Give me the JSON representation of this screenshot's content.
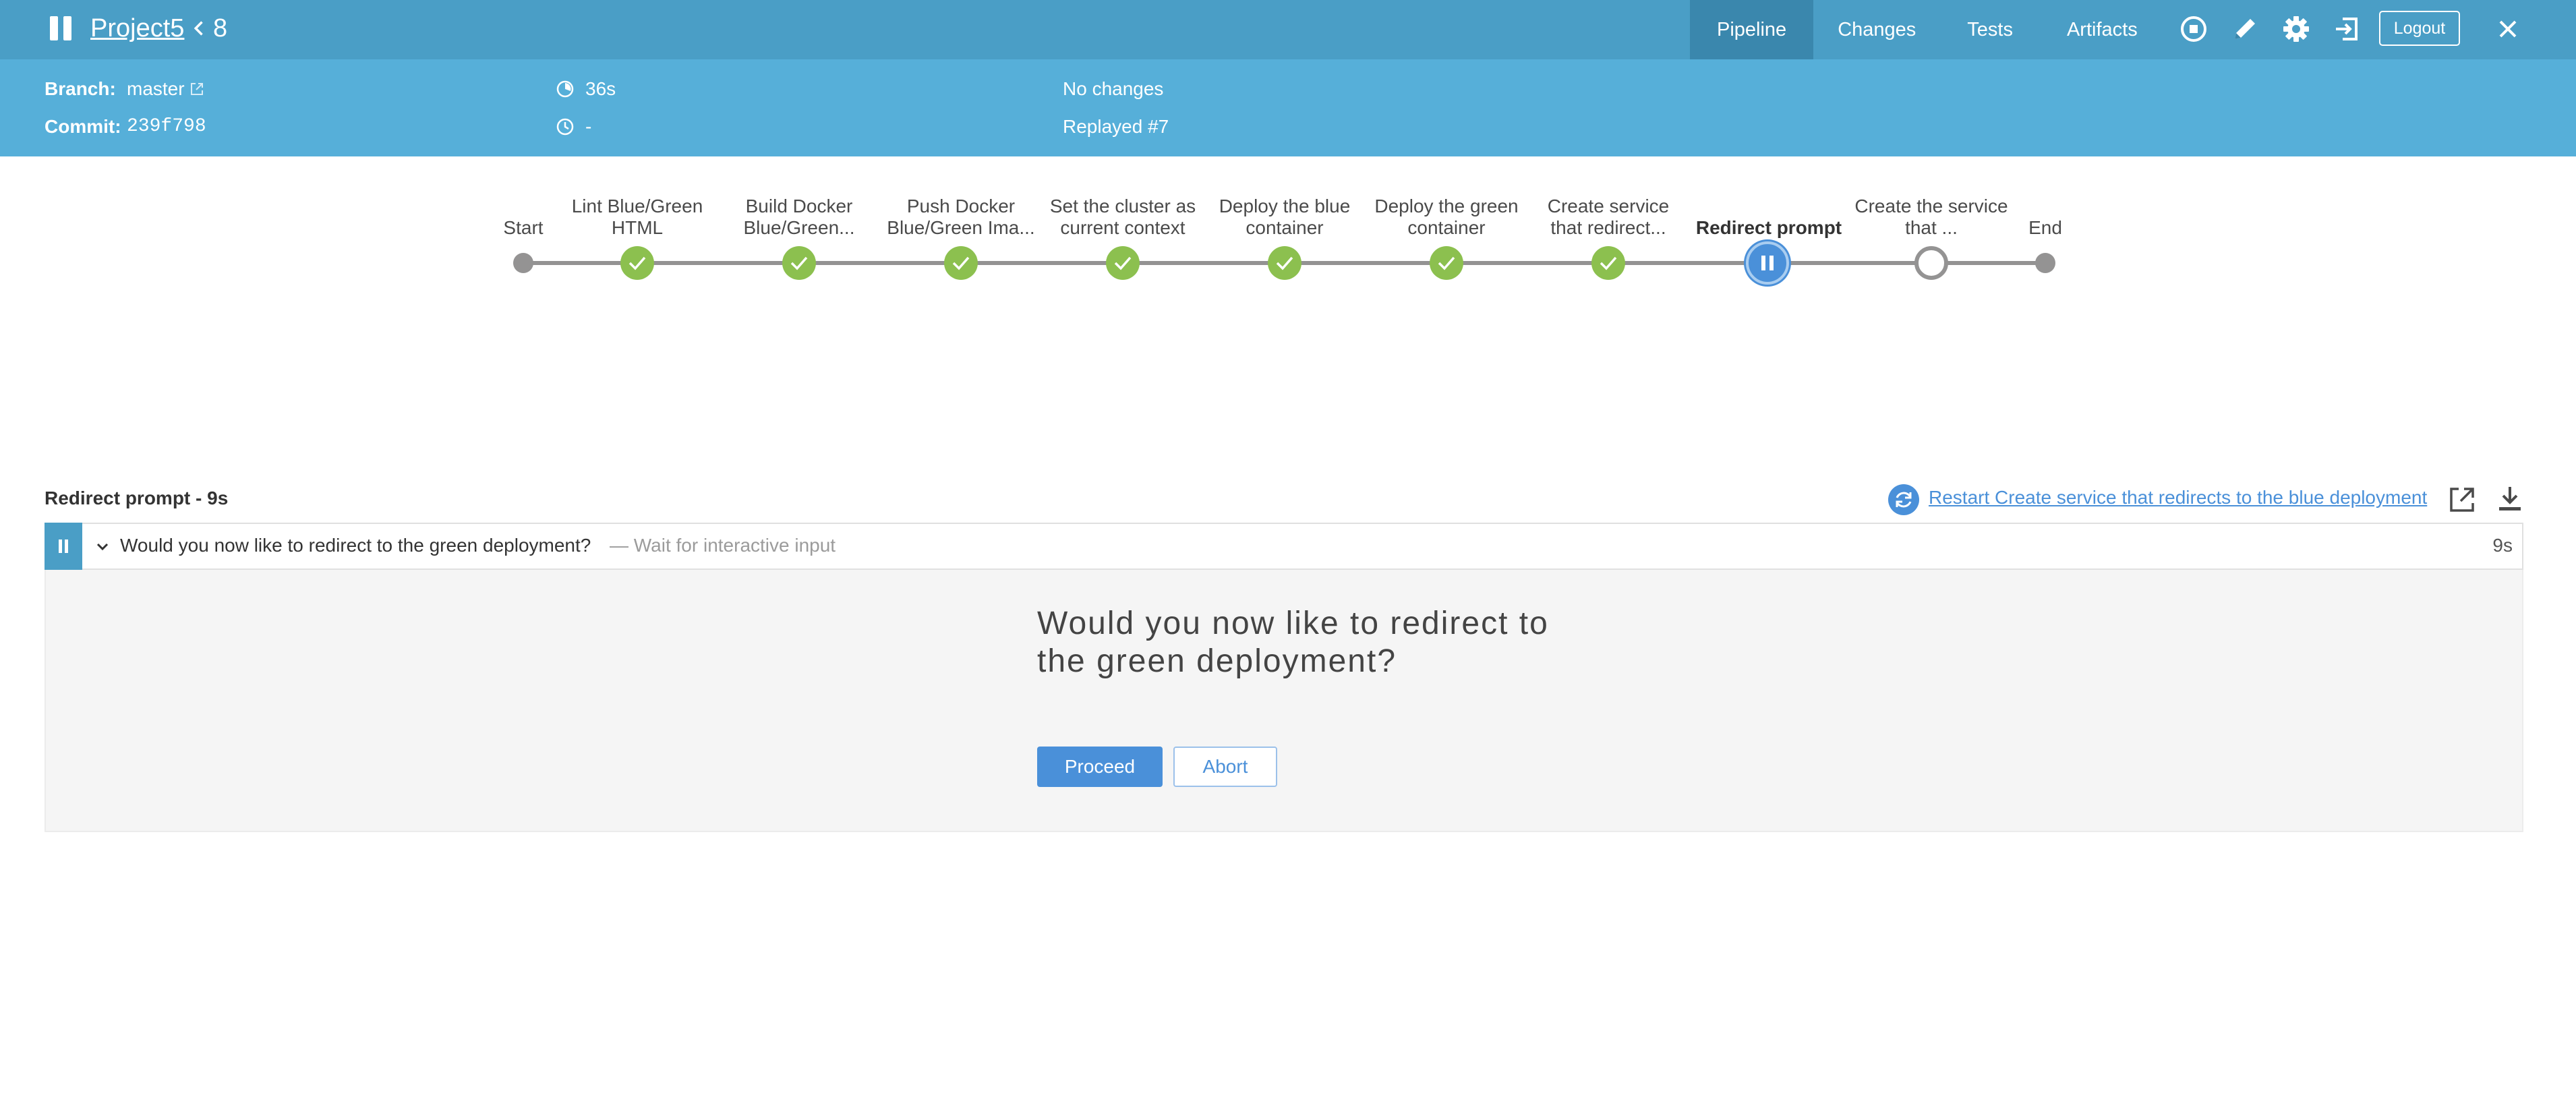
{
  "header": {
    "project": "Project5",
    "run_number": "8",
    "tabs": [
      "Pipeline",
      "Changes",
      "Tests",
      "Artifacts"
    ],
    "active_tab": "Pipeline",
    "logout_label": "Logout",
    "icons": [
      "pause-icon",
      "back-chevron-icon",
      "stop-icon",
      "edit-icon",
      "gear-icon",
      "exit-icon",
      "close-icon"
    ],
    "bar_color": "#4a9ec6"
  },
  "info": {
    "branch_label": "Branch:",
    "branch_value": "master",
    "commit_label": "Commit:",
    "commit_value": "239f798",
    "duration": "36s",
    "time_ago": "-",
    "changes": "No changes",
    "replayed": "Replayed #7",
    "bar_color": "#56afd9"
  },
  "pipeline": {
    "stages": [
      {
        "label": "Start",
        "state": "start"
      },
      {
        "label": "Lint Blue/Green HTML",
        "label_line1": "Lint Blue/Green",
        "label_line2": "HTML",
        "state": "success"
      },
      {
        "label_line1": "Build Docker",
        "label_line2": "Blue/Green...",
        "state": "success"
      },
      {
        "label_line1": "Push Docker",
        "label_line2": "Blue/Green Ima...",
        "state": "success"
      },
      {
        "label_line1": "Set the cluster as",
        "label_line2": "current context",
        "state": "success"
      },
      {
        "label_line1": "Deploy the blue",
        "label_line2": "container",
        "state": "success"
      },
      {
        "label_line1": "Deploy the green",
        "label_line2": "container",
        "state": "success"
      },
      {
        "label_line1": "Create service",
        "label_line2": "that redirect...",
        "state": "success"
      },
      {
        "label": "Redirect prompt",
        "state": "paused"
      },
      {
        "label_line1": "Create the service",
        "label_line2": "that ...",
        "state": "queued"
      },
      {
        "label": "End",
        "state": "end"
      }
    ],
    "colors": {
      "success": "#8cc04f",
      "paused": "#4a90d9",
      "line": "#949393"
    }
  },
  "step": {
    "title": "Redirect prompt - 9s",
    "restart_label": "Restart Create service that redirects to the blue deployment",
    "row_text": "Would you now like to redirect to the green deployment?",
    "row_sub": "— Wait for interactive input",
    "duration": "9s"
  },
  "input": {
    "message_line1": "Would you now like to redirect to",
    "message_line2": "the green deployment?",
    "proceed_label": "Proceed",
    "abort_label": "Abort"
  }
}
